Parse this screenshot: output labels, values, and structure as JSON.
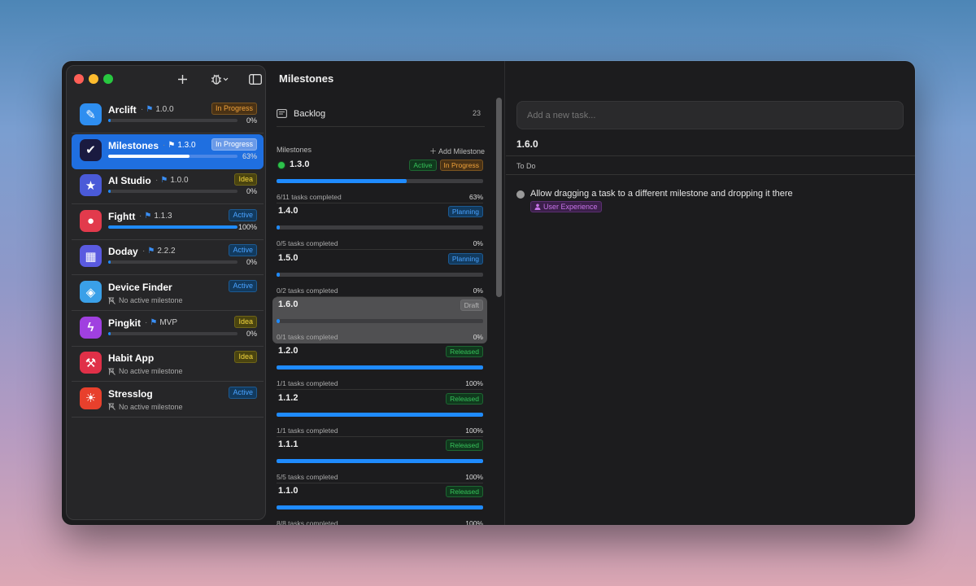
{
  "sidebar": {
    "projects": [
      {
        "name": "Arclift",
        "version": "1.0.0",
        "status": "In Progress",
        "status_type": "progress",
        "progress": 0,
        "pct": "0%",
        "color": "#2e8ef0",
        "icon": "pen-icon",
        "glyph": "✎"
      },
      {
        "name": "Milestones",
        "version": "1.3.0",
        "status": "In Progress",
        "status_type": "progress",
        "progress": 0.63,
        "pct": "63%",
        "color": "#1a1a40",
        "icon": "checkmark-icon",
        "glyph": "✔",
        "selected": true
      },
      {
        "name": "AI Studio",
        "version": "1.0.0",
        "status": "Idea",
        "status_type": "idea",
        "progress": 0,
        "pct": "0%",
        "color": "#4a5ad8",
        "icon": "star-icon",
        "glyph": "★"
      },
      {
        "name": "Fightt",
        "version": "1.1.3",
        "status": "Active",
        "status_type": "active",
        "progress": 1,
        "pct": "100%",
        "color": "#e23a4c",
        "icon": "person-icon",
        "glyph": "●"
      },
      {
        "name": "Doday",
        "version": "2.2.2",
        "status": "Active",
        "status_type": "active",
        "progress": 0,
        "pct": "0%",
        "color": "#5a5ae0",
        "icon": "calendar-icon",
        "glyph": "▦"
      },
      {
        "name": "Device Finder",
        "status": "Active",
        "status_type": "active",
        "no_milestone": "No active milestone",
        "color": "#3aa0e8",
        "icon": "tag-icon",
        "glyph": "◈"
      },
      {
        "name": "Pingkit",
        "version": "MVP",
        "status": "Idea",
        "status_type": "idea",
        "progress": 0,
        "pct": "0%",
        "color": "#a040e0",
        "icon": "bolt-icon",
        "glyph": "ϟ"
      },
      {
        "name": "Habit App",
        "status": "Idea",
        "status_type": "idea",
        "no_milestone": "No active milestone",
        "color": "#e03048",
        "icon": "hammer-icon",
        "glyph": "⚒"
      },
      {
        "name": "Stresslog",
        "status": "Active",
        "status_type": "active",
        "no_milestone": "No active milestone",
        "color": "#e8402c",
        "icon": "sun-icon",
        "glyph": "☀"
      }
    ]
  },
  "middle": {
    "title": "Milestones",
    "backlog_label": "Backlog",
    "backlog_count": "23",
    "section_label": "Milestones",
    "add_label": "Add Milestone",
    "milestones": [
      {
        "version": "1.3.0",
        "badges": [
          {
            "label": "Active",
            "type": "active"
          },
          {
            "label": "In Progress",
            "type": "progress"
          }
        ],
        "progress": 0.63,
        "count": "6/11 tasks completed",
        "pct": "63%",
        "current": true
      },
      {
        "version": "1.4.0",
        "badges": [
          {
            "label": "Planning",
            "type": "planning"
          }
        ],
        "progress": 0,
        "count": "0/5 tasks completed",
        "pct": "0%"
      },
      {
        "version": "1.5.0",
        "badges": [
          {
            "label": "Planning",
            "type": "planning"
          }
        ],
        "progress": 0,
        "count": "0/2 tasks completed",
        "pct": "0%"
      },
      {
        "version": "1.6.0",
        "badges": [
          {
            "label": "Draft",
            "type": "draft"
          }
        ],
        "progress": 0,
        "count": "0/1 tasks completed",
        "pct": "0%",
        "selected": true
      },
      {
        "version": "1.2.0",
        "badges": [
          {
            "label": "Released",
            "type": "released"
          }
        ],
        "progress": 1,
        "count": "1/1 tasks completed",
        "pct": "100%"
      },
      {
        "version": "1.1.2",
        "badges": [
          {
            "label": "Released",
            "type": "released"
          }
        ],
        "progress": 1,
        "count": "1/1 tasks completed",
        "pct": "100%"
      },
      {
        "version": "1.1.1",
        "badges": [
          {
            "label": "Released",
            "type": "released"
          }
        ],
        "progress": 1,
        "count": "5/5 tasks completed",
        "pct": "100%"
      },
      {
        "version": "1.1.0",
        "badges": [
          {
            "label": "Released",
            "type": "released"
          }
        ],
        "progress": 1,
        "count": "8/8 tasks completed",
        "pct": "100%"
      }
    ]
  },
  "right": {
    "add_task_placeholder": "Add a new task...",
    "milestone_title": "1.6.0",
    "todo_label": "To Do",
    "task_text": "Allow dragging a task to a different milestone and dropping it there",
    "task_tag": "User Experience"
  }
}
